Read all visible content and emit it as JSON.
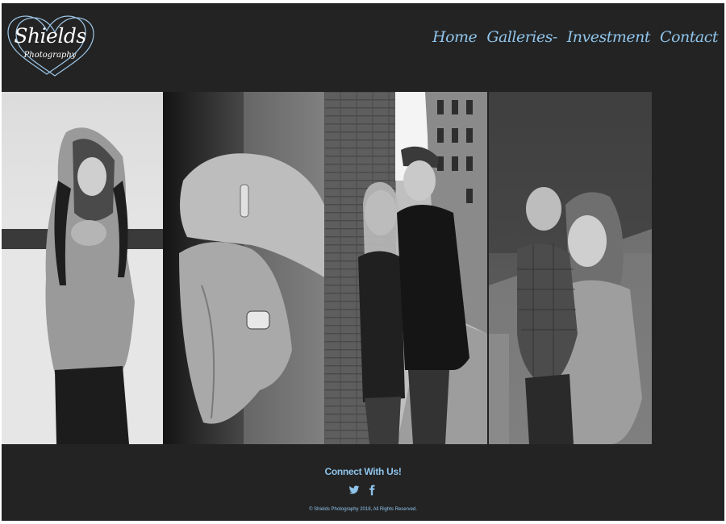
{
  "brand": {
    "name": "Shields",
    "tagline": "Photography"
  },
  "nav": {
    "items": [
      {
        "label": "Home"
      },
      {
        "label": "Galleries-"
      },
      {
        "label": "Investment"
      },
      {
        "label": "Contact"
      }
    ]
  },
  "gallery": {
    "photos": [
      {
        "name": "woman-in-hooded-sweater-snow-photo"
      },
      {
        "name": "engagement-ring-hands-photo"
      },
      {
        "name": "couple-brick-wall-photo"
      },
      {
        "name": "mother-and-son-photo"
      }
    ]
  },
  "footer": {
    "heading": "Connect With Us!",
    "social": [
      {
        "icon": "twitter-icon"
      },
      {
        "icon": "facebook-icon"
      }
    ],
    "copyright": "© Shields Photography 2018, All Rights Reserved."
  },
  "colors": {
    "background": "#232323",
    "accent": "#8fc3ea",
    "logo_outline": "#9ec7e8"
  }
}
